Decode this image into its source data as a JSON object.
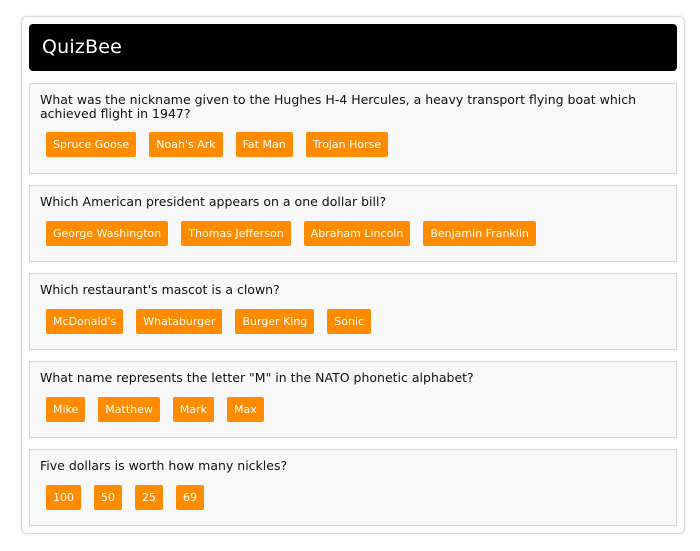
{
  "app": {
    "title": "QuizBee"
  },
  "questions": [
    {
      "text": "What was the nickname given to the Hughes H-4 Hercules, a heavy transport flying boat which achieved flight in 1947?",
      "answers": [
        "Spruce Goose",
        "Noah's Ark",
        "Fat Man",
        "Trojan Horse"
      ]
    },
    {
      "text": "Which American president appears on a one dollar bill?",
      "answers": [
        "George Washington",
        "Thomas Jefferson",
        "Abraham Lincoln",
        "Benjamin Franklin"
      ]
    },
    {
      "text": "Which restaurant's mascot is a clown?",
      "answers": [
        "McDonald's",
        "Whataburger",
        "Burger King",
        "Sonic"
      ]
    },
    {
      "text": "What name represents the letter \"M\" in the NATO phonetic alphabet?",
      "answers": [
        "Mike",
        "Matthew",
        "Mark",
        "Max"
      ]
    },
    {
      "text": "Five dollars is worth how many nickles?",
      "answers": [
        "100",
        "50",
        "25",
        "69"
      ]
    }
  ],
  "colors": {
    "header_bg": "#000000",
    "header_text": "#ffffff",
    "answer_button": "#ff8c00",
    "card_bg": "#f8f8f8"
  }
}
